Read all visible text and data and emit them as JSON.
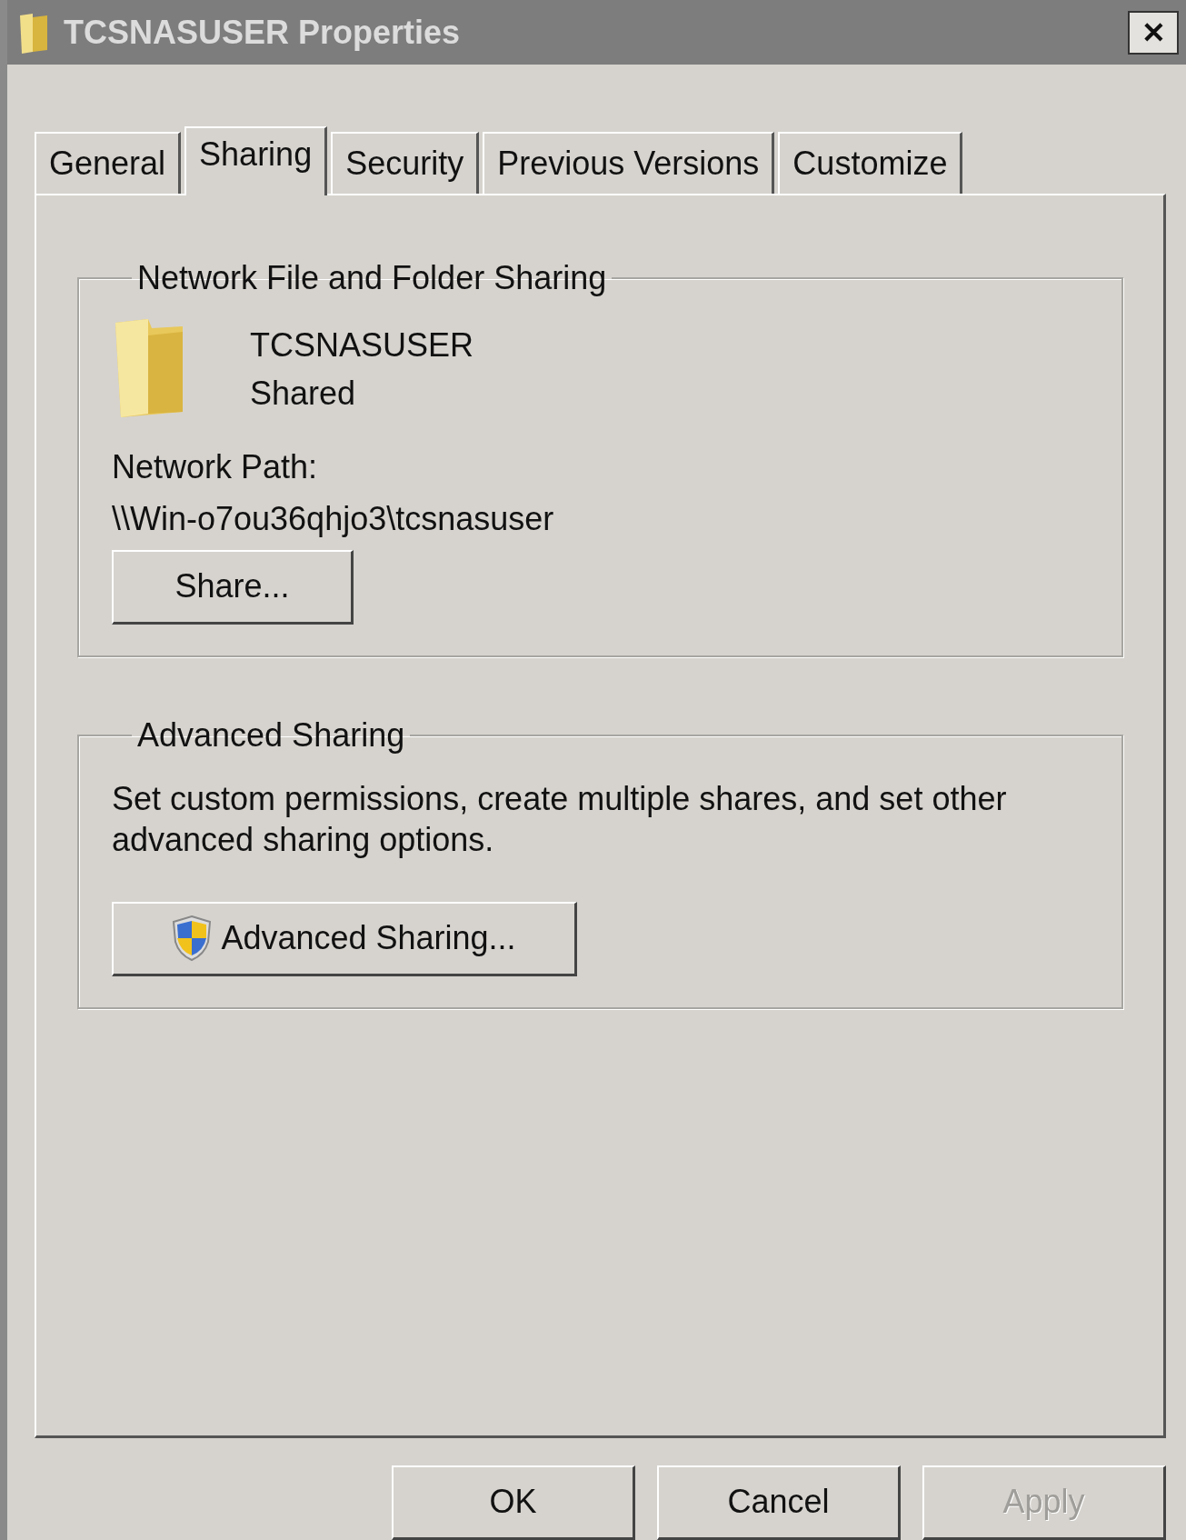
{
  "window": {
    "title": "TCSNASUSER Properties",
    "close": "✕"
  },
  "tabs": [
    {
      "label": "General",
      "selected": false
    },
    {
      "label": "Sharing",
      "selected": true
    },
    {
      "label": "Security",
      "selected": false
    },
    {
      "label": "Previous Versions",
      "selected": false
    },
    {
      "label": "Customize",
      "selected": false
    }
  ],
  "network_sharing": {
    "legend": "Network File and Folder Sharing",
    "folder_name": "TCSNASUSER",
    "status": "Shared",
    "path_label": "Network Path:",
    "path": "\\\\Win-o7ou36qhjo3\\tcsnasuser",
    "button": "Share..."
  },
  "advanced_sharing": {
    "legend": "Advanced Sharing",
    "description": "Set custom permissions, create multiple shares, and set other advanced sharing options.",
    "button": "Advanced Sharing..."
  },
  "buttons": [
    {
      "label": "OK",
      "disabled": false
    },
    {
      "label": "Cancel",
      "disabled": false
    },
    {
      "label": "Apply",
      "disabled": true
    }
  ]
}
